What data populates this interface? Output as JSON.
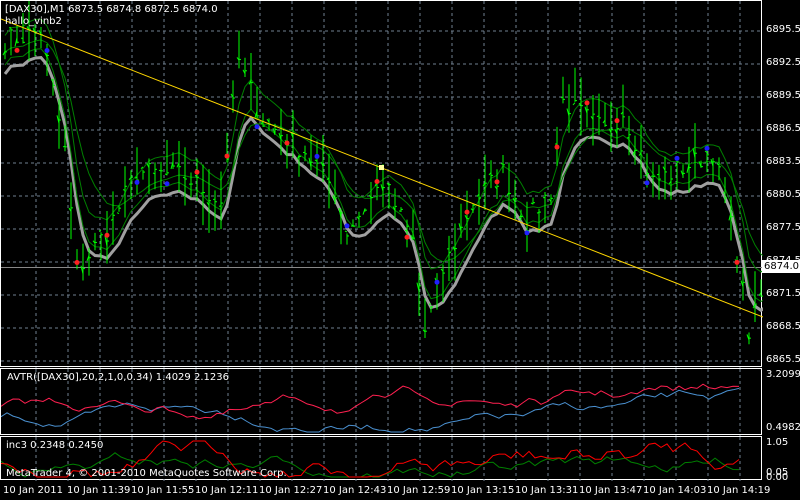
{
  "header": {
    "symbol_line": "[DAX30],M1  6873.5 6874.8 6872.5 6874.0",
    "indicator": "hallo_vinb2"
  },
  "price_axis": [
    "6895.5",
    "6892.5",
    "6889.5",
    "6886.5",
    "6883.5",
    "6880.5",
    "6877.5",
    "6874.5",
    "6871.5",
    "6868.5",
    "6865.5"
  ],
  "current_price": "6874.0",
  "avtr": {
    "label": "AVTR([DAX30],20,2,1,0,0.34) 1.4029 2.1236",
    "axis": [
      "3.2099",
      "0.4982"
    ]
  },
  "inc3": {
    "label": "inc3 0.2348 0.2450",
    "axis": [
      "1.05",
      "0.05",
      "0.00"
    ]
  },
  "copyright": "MetaTrader 4, © 2001-2010 MetaQuotes Software Corp.",
  "time_axis": [
    "10 Jan 2011",
    "10 Jan 11:39",
    "10 Jan 11:55",
    "10 Jan 12:11",
    "10 Jan 12:27",
    "10 Jan 12:43",
    "10 Jan 12:59",
    "10 Jan 13:15",
    "10 Jan 13:31",
    "10 Jan 13:47",
    "10 Jan 14:03",
    "10 Jan 14:19"
  ],
  "colors": {
    "bars": "#00ff00",
    "ma": "#008000",
    "envelope": "#a0a0a0",
    "trendline": "#ffd700",
    "avtr1": "#ff2050",
    "avtr2": "#4a90d0",
    "inc_red": "#ff0000",
    "inc_green": "#008000",
    "grid": "#708090"
  },
  "price_path": [
    [
      0,
      6894.6
    ],
    [
      6,
      6895.5
    ],
    [
      10,
      6884.6
    ],
    [
      12,
      6873.7
    ],
    [
      17,
      6877.3
    ],
    [
      22,
      6882.7
    ],
    [
      30,
      6882.3
    ],
    [
      36,
      6880
    ],
    [
      39,
      6892.8
    ],
    [
      43,
      6887.3
    ],
    [
      50,
      6884.6
    ],
    [
      55,
      6881
    ],
    [
      57,
      6877.3
    ],
    [
      63,
      6881.8
    ],
    [
      68,
      6876.4
    ],
    [
      70,
      6868.2
    ],
    [
      73,
      6873.7
    ],
    [
      78,
      6880
    ],
    [
      83,
      6882.7
    ],
    [
      87,
      6878.2
    ],
    [
      91,
      6881
    ],
    [
      93,
      6889.1
    ],
    [
      100,
      6886.4
    ],
    [
      103,
      6888.2
    ],
    [
      108,
      6881.8
    ],
    [
      115,
      6883.6
    ],
    [
      118,
      6884.6
    ],
    [
      122,
      6875.5
    ],
    [
      124,
      6868.2
    ],
    [
      127,
      6872.8
    ]
  ]
}
